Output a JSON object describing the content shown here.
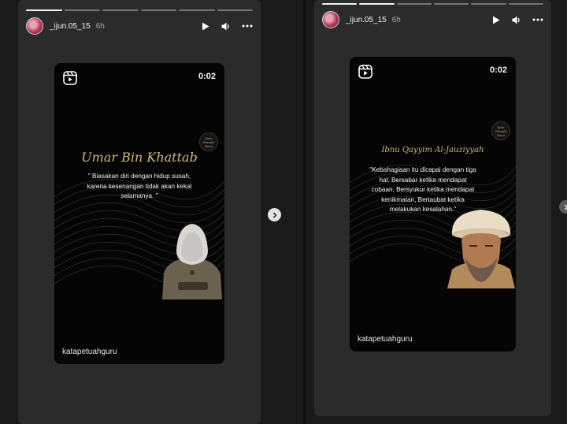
{
  "stories": [
    {
      "username": "_ijun.05_15",
      "time": "6h",
      "card": {
        "duration": "0:02",
        "brand": "katapetuahguru",
        "logo_text": [
          "Kata",
          "Petuah",
          "Guru"
        ],
        "quote_title": "Umar Bin Khattab",
        "quote_lines": [
          "\" Biasakan diri dengan hidup susah,",
          "karena kesenangan tidak akan kekal",
          "selamanya. \""
        ]
      }
    },
    {
      "username": "_ijun.05_15",
      "time": "6h",
      "card": {
        "duration": "0:02",
        "brand": "katapetuahguru",
        "logo_text": [
          "Kata",
          "Petuah",
          "Guru"
        ],
        "quote_title": "Ibnu Qayyim Al-Jauziyyah",
        "quote_lines": [
          "\"Kebahagiaan itu dicapai dengan tiga",
          "hal: Bersabar ketika mendapat",
          "cobaan, Bersyukur ketika mendapat",
          "kenikmatan, Bertaubat ketika",
          "melakukan kesalahan.\""
        ]
      }
    }
  ],
  "icons": {
    "play": "play-icon",
    "volume": "volume-icon",
    "more": "more-icon",
    "reels": "reels-icon",
    "next": "chevron-right-icon"
  },
  "colors": {
    "panel": "#2b2b2b",
    "card": "#050505",
    "gold": "#d6b775"
  }
}
